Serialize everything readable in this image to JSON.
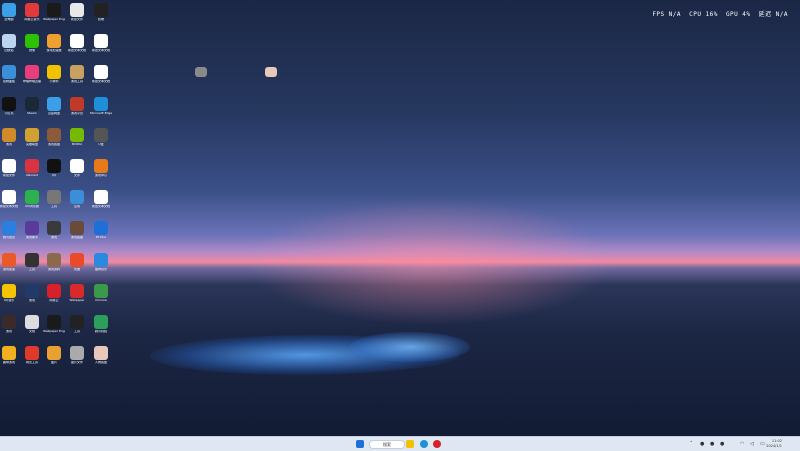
{
  "overlay": {
    "fps_label": "FPS",
    "fps_value": "N/A",
    "cpu_label": "CPU",
    "cpu_value": "16%",
    "gpu_label": "GPU",
    "gpu_value": "4%",
    "extra_label": "延迟",
    "extra_value": "N/A"
  },
  "desktop_icons": [
    {
      "label": "此电脑",
      "color": "#3aa0e8"
    },
    {
      "label": "网易云音乐",
      "color": "#e23a3a"
    },
    {
      "label": "Wallpaper Engine",
      "color": "#1a1a1a"
    },
    {
      "label": "新建文件",
      "color": "#e8e8e8"
    },
    {
      "label": "终端",
      "color": "#222"
    },
    {
      "label": "回收站",
      "color": "#bcd4ee"
    },
    {
      "label": "微信",
      "color": "#2dc100"
    },
    {
      "label": "游戏加速器",
      "color": "#f0a030"
    },
    {
      "label": "新建文本文档",
      "color": "#ffffff"
    },
    {
      "label": "新建文本文档",
      "color": "#ffffff"
    },
    {
      "label": "控制面板",
      "color": "#3a8fd8"
    },
    {
      "label": "哔哩哔哩直播",
      "color": "#e83e7a"
    },
    {
      "label": "小黄鸭",
      "color": "#f2c200"
    },
    {
      "label": "游戏工具",
      "color": "#c8a060"
    },
    {
      "label": "新建文本文档",
      "color": "#ffffff"
    },
    {
      "label": "小红书",
      "color": "#111"
    },
    {
      "label": "Steam",
      "color": "#1b2838"
    },
    {
      "label": "百度网盘",
      "color": "#3a9ee8"
    },
    {
      "label": "游戏平台",
      "color": "#c03a2a"
    },
    {
      "label": "Microsoft Edge",
      "color": "#1e8fd8"
    },
    {
      "label": "游戏",
      "color": "#d08a2a"
    },
    {
      "label": "英雄联盟",
      "color": "#d0a030"
    },
    {
      "label": "游戏截图",
      "color": "#8a5a3a"
    },
    {
      "label": "NVIDIA",
      "color": "#76b900"
    },
    {
      "label": "U盘",
      "color": "#555"
    },
    {
      "label": "新建文件",
      "color": "#ffffff"
    },
    {
      "label": "Valorant",
      "color": "#d9333f"
    },
    {
      "label": "QQ",
      "color": "#111"
    },
    {
      "label": "文件",
      "color": "#ffffff"
    },
    {
      "label": "游戏中心",
      "color": "#e87a1a"
    },
    {
      "label": "新建文本文档",
      "color": "#ffffff"
    },
    {
      "label": "QQ浏览器",
      "color": "#2bb24c"
    },
    {
      "label": "工具",
      "color": "#777"
    },
    {
      "label": "应用",
      "color": "#3a8fd8"
    },
    {
      "label": "新建文本文档",
      "color": "#ffffff"
    },
    {
      "label": "腾讯会议",
      "color": "#2a7fe0"
    },
    {
      "label": "游戏助手",
      "color": "#5a3a9a"
    },
    {
      "label": "游戏",
      "color": "#3a3a3a"
    },
    {
      "label": "游戏截图",
      "color": "#6a4a3a"
    },
    {
      "label": "PS Plus",
      "color": "#1f6fd8"
    },
    {
      "label": "游戏加速",
      "color": "#e85a2a"
    },
    {
      "label": "工具",
      "color": "#333"
    },
    {
      "label": "游戏资料",
      "color": "#8a6a4a"
    },
    {
      "label": "优酷",
      "color": "#e84a2a"
    },
    {
      "label": "酷狗音乐",
      "color": "#2a8ae0"
    },
    {
      "label": "QQ音乐",
      "color": "#f5c400"
    },
    {
      "label": "游戏",
      "color": "#223a6a"
    },
    {
      "label": "网易云",
      "color": "#d8202a"
    },
    {
      "label": "Wallpaper",
      "color": "#d82a2a"
    },
    {
      "label": "Chrome",
      "color": "#3a9a4a"
    },
    {
      "label": "游戏",
      "color": "#3a2a2a"
    },
    {
      "label": "文档",
      "color": "#dddddd"
    },
    {
      "label": "Wallpaper Engine",
      "color": "#1a1a1a"
    },
    {
      "label": "工具",
      "color": "#222"
    },
    {
      "label": "腾讯视频",
      "color": "#2aa05a"
    },
    {
      "label": "趣味游戏",
      "color": "#f0b020"
    },
    {
      "label": "网页工具",
      "color": "#e03a2a"
    },
    {
      "label": "图片",
      "color": "#e8a030"
    },
    {
      "label": "图片文件",
      "color": "#aaaaaa"
    },
    {
      "label": "人物截图",
      "color": "#e8c8b8"
    }
  ],
  "taskbar": {
    "search_label": "搜索",
    "time": "11:02",
    "date": "2024/1/1"
  }
}
